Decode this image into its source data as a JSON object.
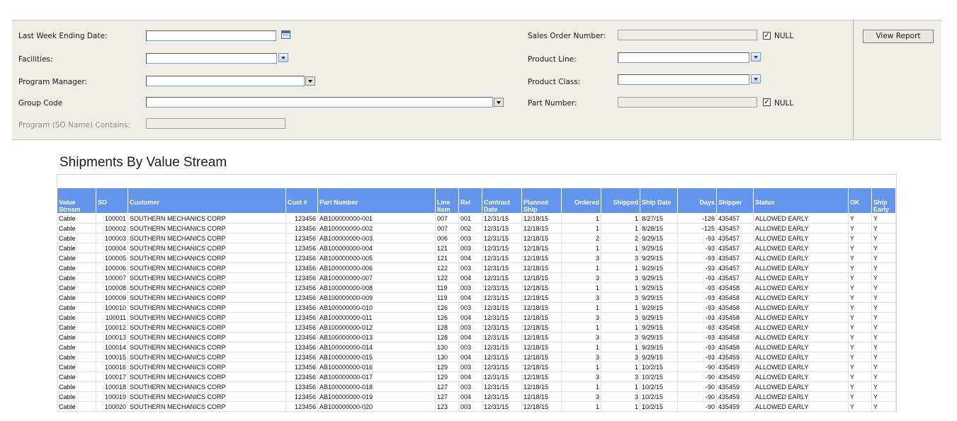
{
  "params": {
    "last_week_ending_date": {
      "label": "Last Week Ending Date:",
      "value": ""
    },
    "facilities": {
      "label": "Facilities:",
      "value": ""
    },
    "program_manager": {
      "label": "Program Manager:",
      "value": ""
    },
    "group_code": {
      "label": "Group Code",
      "value": ""
    },
    "program_contains": {
      "label": "Program (SO Name) Contains:",
      "value": ""
    },
    "sales_order_number": {
      "label": "Sales Order Number:",
      "value": "",
      "null_label": "NULL",
      "null_checked": true
    },
    "product_line": {
      "label": "Product Line:",
      "value": ""
    },
    "product_class": {
      "label": "Product Class:",
      "value": ""
    },
    "part_number": {
      "label": "Part Number:",
      "value": "",
      "null_label": "NULL",
      "null_checked": true
    },
    "view_report_label": "View Report",
    "check_mark": "✓"
  },
  "report": {
    "title": "Shipments By Value Stream",
    "columns": [
      "Value Stream",
      "SO",
      "Customer",
      "Cust #",
      "Part Number",
      "Line Item",
      "Rel",
      "Contract Date",
      "Planned Ship",
      "Ordered",
      "Shipped",
      "Ship Date",
      "Days",
      "Shipper",
      "Status",
      "OK",
      "Ship Early"
    ],
    "rows": [
      [
        "Cable",
        "100001",
        "SOUTHERN MECHANICS CORP",
        "123456",
        "AB100000000-001",
        "007",
        "001",
        "12/31/15",
        "12/18/15",
        "1",
        "1",
        "8/27/15",
        "-126",
        "435457",
        "ALLOWED EARLY",
        "Y",
        "Y"
      ],
      [
        "Cable",
        "100002",
        "SOUTHERN MECHANICS CORP",
        "123456",
        "AB100000000-002",
        "007",
        "002",
        "12/31/15",
        "12/18/15",
        "1",
        "1",
        "8/28/15",
        "-125",
        "435457",
        "ALLOWED EARLY",
        "Y",
        "Y"
      ],
      [
        "Cable",
        "100003",
        "SOUTHERN MECHANICS CORP",
        "123456",
        "AB100000000-003",
        "006",
        "003",
        "12/31/15",
        "12/18/15",
        "2",
        "2",
        "9/29/15",
        "-93",
        "435457",
        "ALLOWED EARLY",
        "Y",
        "Y"
      ],
      [
        "Cable",
        "100004",
        "SOUTHERN MECHANICS CORP",
        "123456",
        "AB100000000-004",
        "121",
        "003",
        "12/31/15",
        "12/18/15",
        "1",
        "1",
        "9/29/15",
        "-93",
        "435457",
        "ALLOWED EARLY",
        "Y",
        "Y"
      ],
      [
        "Cable",
        "100005",
        "SOUTHERN MECHANICS CORP",
        "123456",
        "AB100000000-005",
        "121",
        "004",
        "12/31/15",
        "12/18/15",
        "3",
        "3",
        "9/29/15",
        "-93",
        "435457",
        "ALLOWED EARLY",
        "Y",
        "Y"
      ],
      [
        "Cable",
        "100006",
        "SOUTHERN MECHANICS CORP",
        "123456",
        "AB100000000-006",
        "122",
        "003",
        "12/31/15",
        "12/18/15",
        "1",
        "1",
        "9/29/15",
        "-93",
        "435457",
        "ALLOWED EARLY",
        "Y",
        "Y"
      ],
      [
        "Cable",
        "100007",
        "SOUTHERN MECHANICS CORP",
        "123456",
        "AB100000000-007",
        "122",
        "004",
        "12/31/15",
        "12/18/15",
        "3",
        "3",
        "9/29/15",
        "-93",
        "435457",
        "ALLOWED EARLY",
        "Y",
        "Y"
      ],
      [
        "Cable",
        "100008",
        "SOUTHERN MECHANICS CORP",
        "123456",
        "AB100000000-008",
        "119",
        "003",
        "12/31/15",
        "12/18/15",
        "1",
        "1",
        "9/29/15",
        "-93",
        "435458",
        "ALLOWED EARLY",
        "Y",
        "Y"
      ],
      [
        "Cable",
        "100009",
        "SOUTHERN MECHANICS CORP",
        "123456",
        "AB100000000-009",
        "119",
        "004",
        "12/31/15",
        "12/18/15",
        "3",
        "3",
        "9/29/15",
        "-93",
        "435458",
        "ALLOWED EARLY",
        "Y",
        "Y"
      ],
      [
        "Cable",
        "100010",
        "SOUTHERN MECHANICS CORP",
        "123456",
        "AB100000000-010",
        "126",
        "003",
        "12/31/15",
        "12/18/15",
        "1",
        "1",
        "9/29/15",
        "-93",
        "435458",
        "ALLOWED EARLY",
        "Y",
        "Y"
      ],
      [
        "Cable",
        "100011",
        "SOUTHERN MECHANICS CORP",
        "123456",
        "AB100000000-011",
        "126",
        "004",
        "12/31/15",
        "12/18/15",
        "3",
        "3",
        "9/29/15",
        "-93",
        "435458",
        "ALLOWED EARLY",
        "Y",
        "Y"
      ],
      [
        "Cable",
        "100012",
        "SOUTHERN MECHANICS CORP",
        "123456",
        "AB100000000-012",
        "128",
        "003",
        "12/31/15",
        "12/18/15",
        "1",
        "1",
        "9/29/15",
        "-93",
        "435458",
        "ALLOWED EARLY",
        "Y",
        "Y"
      ],
      [
        "Cable",
        "100013",
        "SOUTHERN MECHANICS CORP",
        "123456",
        "AB100000000-013",
        "128",
        "004",
        "12/31/15",
        "12/18/15",
        "3",
        "3",
        "9/29/15",
        "-93",
        "435458",
        "ALLOWED EARLY",
        "Y",
        "Y"
      ],
      [
        "Cable",
        "100014",
        "SOUTHERN MECHANICS CORP",
        "123456",
        "AB100000000-014",
        "130",
        "003",
        "12/31/15",
        "12/18/15",
        "1",
        "1",
        "9/29/15",
        "-93",
        "435458",
        "ALLOWED EARLY",
        "Y",
        "Y"
      ],
      [
        "Cable",
        "100015",
        "SOUTHERN MECHANICS CORP",
        "123456",
        "AB100000000-015",
        "130",
        "004",
        "12/31/15",
        "12/18/15",
        "3",
        "3",
        "9/29/15",
        "-93",
        "435459",
        "ALLOWED EARLY",
        "Y",
        "Y"
      ],
      [
        "Cable",
        "100016",
        "SOUTHERN MECHANICS CORP",
        "123456",
        "AB100000000-016",
        "129",
        "003",
        "12/31/15",
        "12/18/15",
        "1",
        "1",
        "10/2/15",
        "-90",
        "435459",
        "ALLOWED EARLY",
        "Y",
        "Y"
      ],
      [
        "Cable",
        "100017",
        "SOUTHERN MECHANICS CORP",
        "123456",
        "AB100000000-017",
        "129",
        "004",
        "12/31/15",
        "12/18/15",
        "3",
        "3",
        "10/2/15",
        "-90",
        "435459",
        "ALLOWED EARLY",
        "Y",
        "Y"
      ],
      [
        "Cable",
        "100018",
        "SOUTHERN MECHANICS CORP",
        "123456",
        "AB100000000-018",
        "127",
        "003",
        "12/31/15",
        "12/18/15",
        "1",
        "1",
        "10/2/15",
        "-90",
        "435459",
        "ALLOWED EARLY",
        "Y",
        "Y"
      ],
      [
        "Cable",
        "100019",
        "SOUTHERN MECHANICS CORP",
        "123456",
        "AB100000000-019",
        "127",
        "004",
        "12/31/15",
        "12/18/15",
        "3",
        "3",
        "10/2/15",
        "-90",
        "435459",
        "ALLOWED EARLY",
        "Y",
        "Y"
      ],
      [
        "Cable",
        "100020",
        "SOUTHERN MECHANICS CORP",
        "123456",
        "AB100000000-020",
        "123",
        "003",
        "12/31/15",
        "12/18/15",
        "1",
        "1",
        "10/2/15",
        "-90",
        "435459",
        "ALLOWED EARLY",
        "Y",
        "Y"
      ]
    ]
  },
  "colors": {
    "header_bg": "#6495ed",
    "panel_bg": "#efeee4"
  }
}
